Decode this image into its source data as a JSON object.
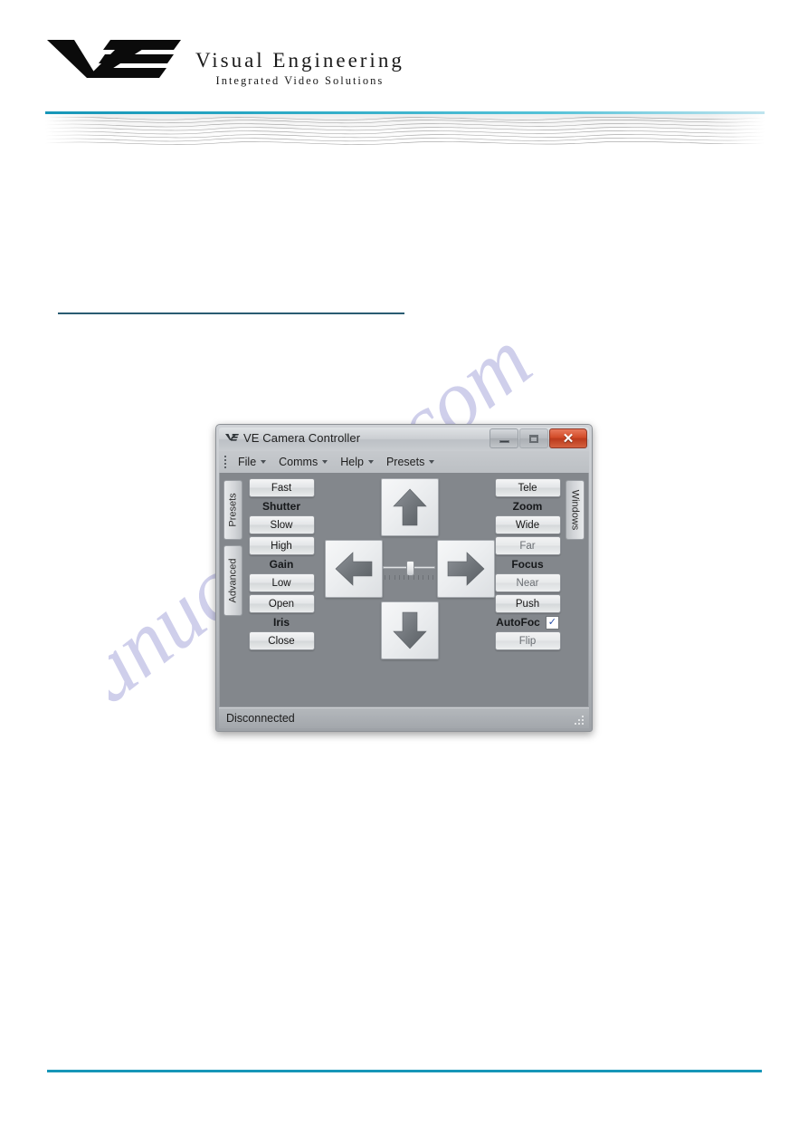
{
  "page_header": {
    "brand_name": "Visual Engineering",
    "brand_tagline": "Integrated Video Solutions",
    "logo_icon": "ve-logo-icon"
  },
  "watermark": {
    "text": "manualshive.com"
  },
  "app": {
    "titlebar": {
      "icon": "ve-app-icon",
      "title": "VE Camera Controller",
      "minimize_label": "–",
      "maximize_label": "□",
      "close_label": "✕"
    },
    "menubar": {
      "grip": "menu-grip-icon",
      "items": [
        {
          "label": "File"
        },
        {
          "label": "Comms"
        },
        {
          "label": "Help"
        },
        {
          "label": "Presets"
        }
      ]
    },
    "side_tabs": {
      "left": [
        {
          "label": "Presets"
        },
        {
          "label": "Advanced"
        }
      ],
      "right": [
        {
          "label": "Windows"
        }
      ]
    },
    "left_panel": {
      "groups": [
        {
          "top_button": "Fast",
          "label": "Shutter",
          "bottom_button": "Slow"
        },
        {
          "top_button": "High",
          "label": "Gain",
          "bottom_button": "Low"
        },
        {
          "top_button": "Open",
          "label": "Iris",
          "bottom_button": "Close"
        }
      ]
    },
    "dpad": {
      "up": "arrow-up-button",
      "left": "arrow-left-button",
      "right": "arrow-right-button",
      "down": "arrow-down-button",
      "slider": {
        "name": "speed-slider",
        "value": 50,
        "min": 0,
        "max": 100,
        "tick_count": 11
      }
    },
    "right_panel": {
      "zoom_group": {
        "top_button": "Tele",
        "label": "Zoom",
        "bottom_button": "Wide"
      },
      "focus_group": {
        "top_button": "Far",
        "label": "Focus",
        "bottom_button": "Near"
      },
      "push_button": "Push",
      "autofocus": {
        "label": "AutoFoc",
        "checked": true,
        "check_glyph": "✓"
      },
      "flip_button": "Flip"
    },
    "statusbar": {
      "status": "Disconnected",
      "grip": "resize-grip-icon"
    }
  }
}
